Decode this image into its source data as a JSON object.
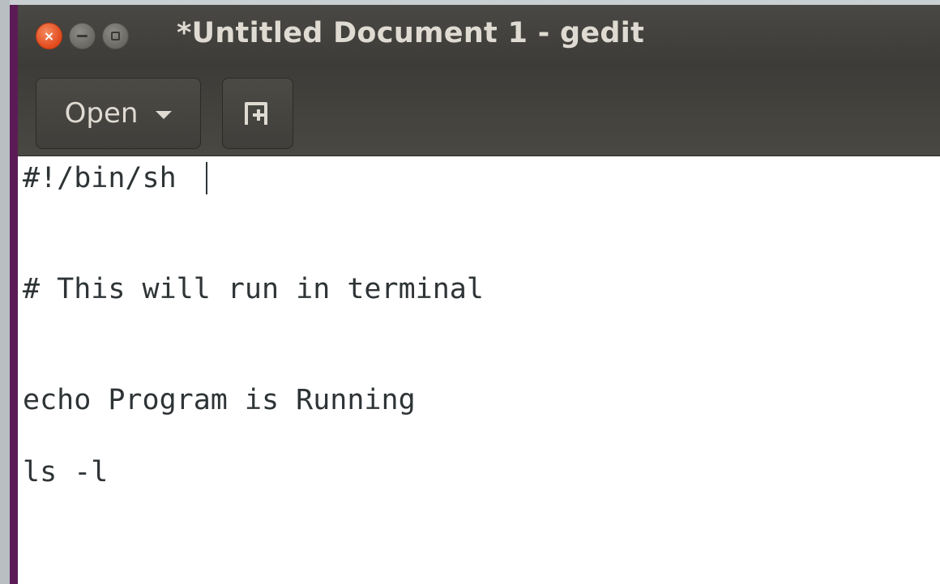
{
  "window": {
    "title": "*Untitled Document 1 - gedit"
  },
  "titlebar": {
    "close_glyph": "×"
  },
  "toolbar": {
    "open_label": "Open",
    "open_icon": "chevron-down-icon",
    "new_tab_icon": "new-tab-icon"
  },
  "editor": {
    "lines": [
      "#!/bin/sh",
      "",
      "# This will run in terminal",
      "",
      "echo Program is Running",
      "ls -l"
    ]
  },
  "colors": {
    "titlebar": "#3c3b37",
    "close_button": "#e0491b",
    "window_border": "#5c1b57",
    "text": "#2e3436"
  }
}
